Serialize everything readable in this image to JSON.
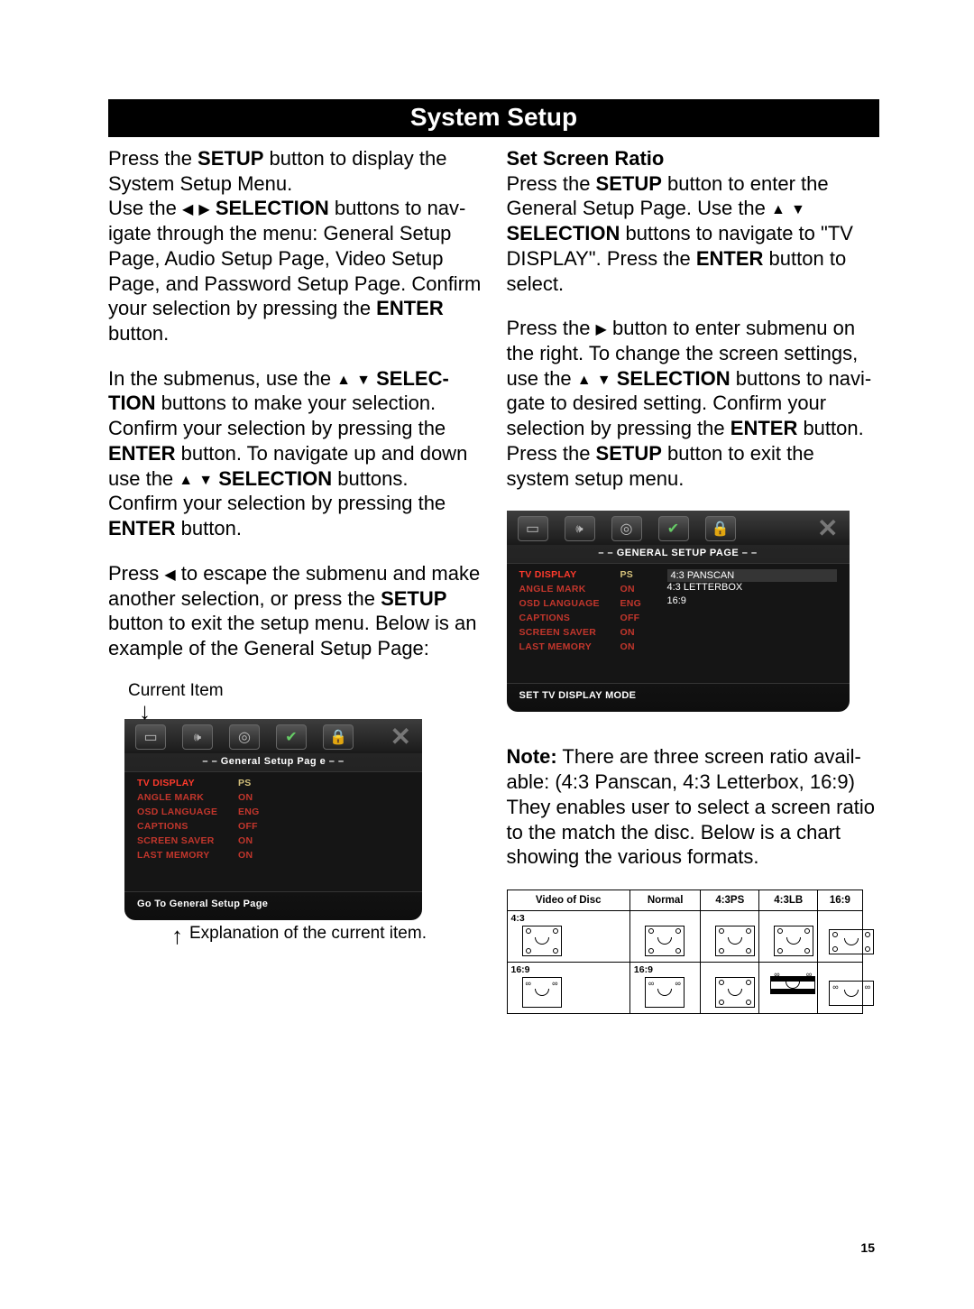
{
  "title": "System Setup",
  "page_number": "15",
  "left": {
    "p1_a": "Press the ",
    "p1_b": "SETUP",
    "p1_c": " button to display the System Setup Menu.",
    "p2_a": "Use the  ",
    "p2_b": "SELECTION",
    "p2_c": " buttons to nav­igate through the menu: General Setup Page, Audio Setup Page, Video Setup Page, and Password Setup Page. Confirm your selection by pressing the ",
    "p2_d": "ENTER",
    "p2_e": " but­ton.",
    "p3_a": "In the submenus, use the ",
    "p3_b": "SELEC­TION",
    "p3_c": " buttons to make your selection. Confirm your selection by pressing the ",
    "p3_d": "ENTER",
    "p3_e": " button. To navigate up and down use the ",
    "p3_f": "SELECTION",
    "p3_g": " buttons. Confirm your selection by pressing the ",
    "p3_h": "ENTER",
    "p3_i": " button.",
    "p4_a": "Press  ",
    "p4_b": " to escape the submenu and make another selection, or press the ",
    "p4_c": "SETUP",
    "p4_d": " button to exit the setup menu. Below is an example of the General Setup Page:",
    "current_item": "Current Item",
    "explanation": "Explanation of the current item."
  },
  "right": {
    "h1": "Set Screen Ratio",
    "p1_a": "Press the ",
    "p1_b": "SETUP",
    "p1_c": " button to enter the General Setup Page. Use the  ",
    "p1_d": "SELECTION",
    "p1_e": " buttons to navigate to \"TV DIS­PLAY\". Press the ",
    "p1_f": "ENTER",
    "p1_g": " button to select.",
    "p2_a": "Press the ",
    "p2_b": " button to enter submenu on the right. To change the screen settings, use the ",
    "p2_c": "SELECTION",
    "p2_d": " buttons to navi­gate to desired setting. Confirm your selec­tion by pressing the ",
    "p2_e": "ENTER",
    "p2_f": " button. Press the ",
    "p2_g": "SETUP",
    "p2_h": " button to exit the system setup menu.",
    "note_a": "Note:",
    "note_b": " There are three screen ratio avail­able: (4:3 Panscan, 4:3 Letterbox, 16:9) They enables user to select a screen ratio to the match the disc. Below is a chart showing the various formats."
  },
  "osd1": {
    "header": "– –   General Setup Pag e   – –",
    "rows": [
      {
        "k": "TV DISPLAY",
        "v": "PS"
      },
      {
        "k": "ANGLE MARK",
        "v": "ON"
      },
      {
        "k": "OSD LANGUAGE",
        "v": "ENG"
      },
      {
        "k": "CAPTIONS",
        "v": "OFF"
      },
      {
        "k": "SCREEN SAVER",
        "v": "ON"
      },
      {
        "k": "LAST MEMORY",
        "v": "ON"
      }
    ],
    "foot": "Go To General Setup Page"
  },
  "osd2": {
    "header": "– –   GENERAL SETUP PAGE – –",
    "rows": [
      {
        "k": "TV DISPLAY",
        "v": "PS"
      },
      {
        "k": "ANGLE MARK",
        "v": "ON"
      },
      {
        "k": "OSD LANGUAGE",
        "v": "ENG"
      },
      {
        "k": "CAPTIONS",
        "v": "OFF"
      },
      {
        "k": "SCREEN SAVER",
        "v": "ON"
      },
      {
        "k": "LAST MEMORY",
        "v": "ON"
      }
    ],
    "opts": [
      "4:3 PANSCAN",
      "4:3 LETTERBOX",
      "16:9"
    ],
    "foot": "SET TV DISPLAY MODE"
  },
  "ratio_table": {
    "headers": [
      "Video of Disc",
      "Normal",
      "4:3PS",
      "4:3LB",
      "16:9"
    ],
    "row_labels": [
      "4:3",
      "16:9"
    ],
    "row2_c2": "16:9"
  }
}
